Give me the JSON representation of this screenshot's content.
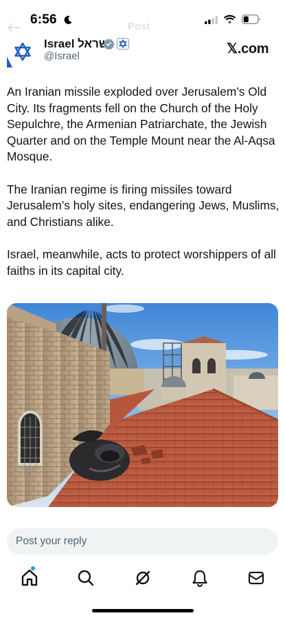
{
  "status_bar": {
    "time": "6:56",
    "icons": [
      "moon-icon",
      "signal-icon",
      "wifi-icon",
      "battery-icon"
    ]
  },
  "faded_header": {
    "title": "Post"
  },
  "tweet": {
    "display_name": "Israel ישראל",
    "handle": "@Israel",
    "source_logo": "𝕏.com",
    "paragraphs": [
      "An Iranian missile exploded over Jerusalem’s Old City. Its fragments fell on the Church of the Holy Sepulchre, the Armenian Patriarchate, the Jewish Quarter and on the Temple Mount near the Al-Aqsa Mosque.",
      "The Iranian regime is firing missiles toward Jerusalem’s holy sites, endangering Jews, Muslims, and Christians alike.",
      "Israel, meanwhile, acts to protect worshippers of all faiths in its capital city."
    ],
    "badges": [
      "verified-icon",
      "government-badge-icon"
    ]
  },
  "reply": {
    "placeholder": "Post your reply"
  },
  "bottom_nav": {
    "items": [
      "home-icon",
      "search-icon",
      "grok-icon",
      "notifications-icon",
      "messages-icon"
    ],
    "home_has_notification_dot": true
  },
  "colors": {
    "text_primary": "#0f1419",
    "text_secondary": "#536471",
    "accent": "#1d9bf0",
    "reply_bg": "#eff3f4"
  }
}
